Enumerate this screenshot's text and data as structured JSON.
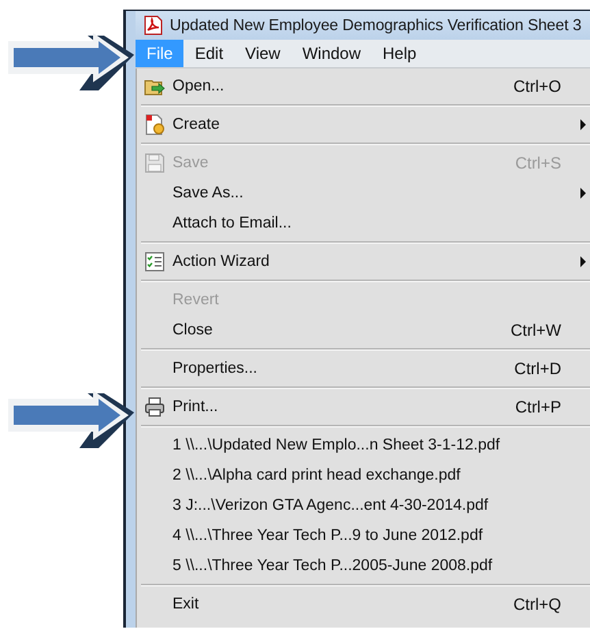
{
  "window": {
    "title": "Updated New Employee Demographics Verification Sheet 3"
  },
  "menubar": [
    {
      "label": "File",
      "selected": true
    },
    {
      "label": "Edit",
      "selected": false
    },
    {
      "label": "View",
      "selected": false
    },
    {
      "label": "Window",
      "selected": false
    },
    {
      "label": "Help",
      "selected": false
    }
  ],
  "menu": [
    {
      "kind": "item",
      "label": "Open...",
      "shortcut": "Ctrl+O",
      "submenu": false,
      "disabled": false
    },
    {
      "kind": "separator"
    },
    {
      "kind": "item",
      "label": "Create",
      "submenu": true,
      "disabled": false
    },
    {
      "kind": "separator"
    },
    {
      "kind": "item",
      "label": "Save",
      "shortcut": "Ctrl+S",
      "submenu": false,
      "disabled": true
    },
    {
      "kind": "item",
      "label": "Save As...",
      "submenu": true,
      "disabled": false
    },
    {
      "kind": "item",
      "label": "Attach to Email...",
      "submenu": false,
      "disabled": false
    },
    {
      "kind": "separator"
    },
    {
      "kind": "item",
      "label": "Action Wizard",
      "submenu": true,
      "disabled": false
    },
    {
      "kind": "separator"
    },
    {
      "kind": "item",
      "label": "Revert",
      "submenu": false,
      "disabled": true
    },
    {
      "kind": "item",
      "label": "Close",
      "shortcut": "Ctrl+W",
      "submenu": false,
      "disabled": false
    },
    {
      "kind": "separator"
    },
    {
      "kind": "item",
      "label": "Properties...",
      "shortcut": "Ctrl+D",
      "submenu": false,
      "disabled": false
    },
    {
      "kind": "separator"
    },
    {
      "kind": "item",
      "label": "Print...",
      "shortcut": "Ctrl+P",
      "submenu": false,
      "disabled": false
    },
    {
      "kind": "separator"
    },
    {
      "kind": "item",
      "label": "1 \\\\...\\Updated New Emplo...n Sheet 3-1-12.pdf",
      "submenu": false,
      "disabled": false
    },
    {
      "kind": "item",
      "label": "2 \\\\...\\Alpha card print head exchange.pdf",
      "submenu": false,
      "disabled": false
    },
    {
      "kind": "item",
      "label": "3 J:...\\Verizon GTA Agenc...ent  4-30-2014.pdf",
      "submenu": false,
      "disabled": false
    },
    {
      "kind": "item",
      "label": "4 \\\\...\\Three Year Tech P...9 to June 2012.pdf",
      "submenu": false,
      "disabled": false
    },
    {
      "kind": "item",
      "label": "5 \\\\...\\Three Year Tech P...2005-June 2008.pdf",
      "submenu": false,
      "disabled": false
    },
    {
      "kind": "separator"
    },
    {
      "kind": "item",
      "label": "Exit",
      "shortcut": "Ctrl+Q",
      "submenu": false,
      "disabled": false
    }
  ]
}
